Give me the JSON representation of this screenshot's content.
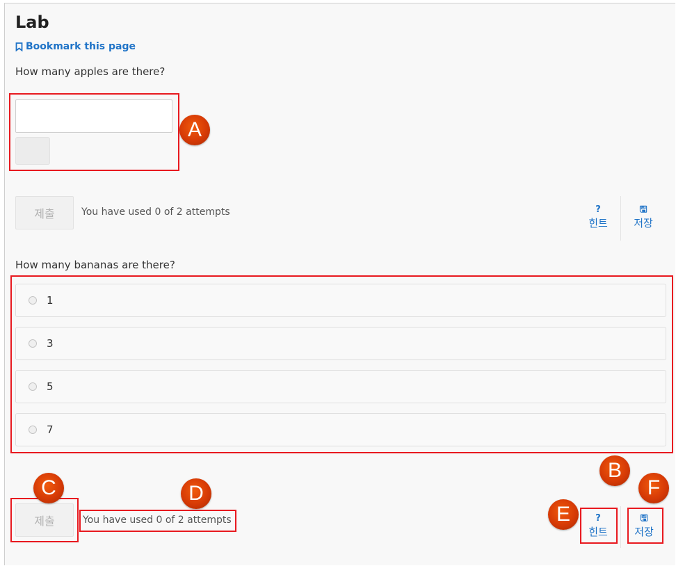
{
  "page": {
    "title": "Lab",
    "bookmark_label": "Bookmark this page"
  },
  "problem1": {
    "question": "How many apples are there?",
    "input_value": "",
    "submit_label": "제출",
    "attempts_text": "You have used 0 of 2 attempts",
    "hint": {
      "glyph": "?",
      "label": "힌트"
    },
    "save": {
      "glyph": "🖫",
      "label": "저장"
    }
  },
  "problem2": {
    "question": "How many bananas are there?",
    "choices": [
      "1",
      "3",
      "5",
      "7"
    ],
    "submit_label": "제출",
    "attempts_text": "You have used 0 of 2 attempts",
    "hint": {
      "glyph": "?",
      "label": "힌트"
    },
    "save": {
      "glyph": "🖫",
      "label": "저장"
    }
  },
  "annotations": {
    "marker_a": "A",
    "marker_b": "B",
    "marker_c": "C",
    "marker_d": "D",
    "marker_e": "E",
    "marker_f": "F"
  },
  "colors": {
    "link": "#1f73c7",
    "annotation_red": "#e8191f",
    "marker_orange": "#d63a06"
  }
}
